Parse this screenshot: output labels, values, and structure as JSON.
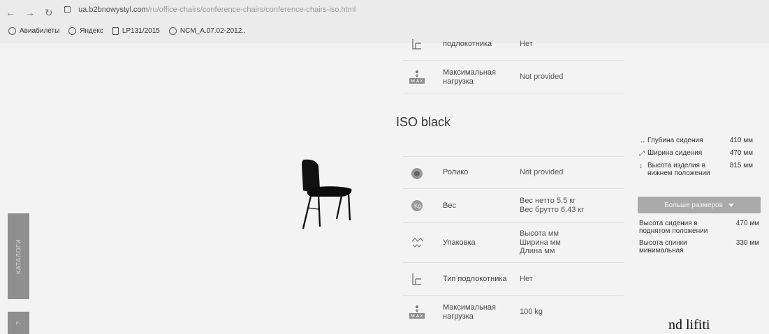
{
  "browser": {
    "back_icon": "back-arrow-icon",
    "forward_icon": "forward-arrow-icon",
    "reload_icon": "reload-icon",
    "url_host": "ua.b2bnowystyl.com",
    "url_path": "/ru/office-chairs/conference-chairs/conference-chairs-iso.html",
    "bookmarks": [
      {
        "label": "Авиабилеты",
        "icon": "globe-icon"
      },
      {
        "label": "Яндекс",
        "icon": "globe-icon"
      },
      {
        "label": "LP131/2015",
        "icon": "file-icon"
      },
      {
        "label": "NCM_A.07.02-2012..",
        "icon": "wordpress-icon"
      }
    ]
  },
  "specs_top": [
    {
      "label": "подлокотника",
      "value": "Нет",
      "icon": "armrest-icon"
    },
    {
      "label": "Максимальная нагрузка",
      "value": "Not provided",
      "icon": "max-load-icon"
    }
  ],
  "product": {
    "title": "ISO black"
  },
  "specs": [
    {
      "label": "Ролико",
      "value": "Not provided",
      "icon": "wheel-icon"
    },
    {
      "label": "Вес",
      "value_lines": [
        "Вес нетто 5.5 кг",
        "Вес брутто 6.43 кг"
      ],
      "icon": "weight-icon"
    },
    {
      "label": "Упаковка",
      "value_lines": [
        "Высота мм",
        "Ширина мм",
        "Длина мм"
      ],
      "icon": "package-icon"
    },
    {
      "label": "Тип подлокотника",
      "value": "Нет",
      "icon": "armrest-icon"
    },
    {
      "label": "Максимальная нагрузка",
      "value": "100 kg",
      "icon": "max-load-icon"
    }
  ],
  "dimensions": [
    {
      "label": "Глубина сидения",
      "value": "410 мм",
      "icon": "depth-icon"
    },
    {
      "label": "Ширина сидения",
      "value": "470 мм",
      "icon": "width-icon"
    },
    {
      "label": "Высота изделия в нижнем положении",
      "value": "815 мм",
      "icon": "height-icon"
    }
  ],
  "more_sizes_label": "Больше размеров",
  "extra_dimensions": [
    {
      "label": "Высота сидения в поднятом положении",
      "value": "470 мм"
    },
    {
      "label": "Высота спинки минимальная",
      "value": "330 мм"
    }
  ],
  "sidebar": {
    "catalog": "КАТАЛОГИ",
    "help": "?"
  },
  "corner_text": "nd lifiti"
}
